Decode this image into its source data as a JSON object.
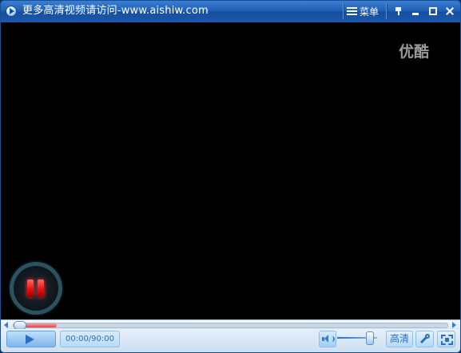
{
  "window": {
    "title": "更多高清视频请访问-www.aishiw.com",
    "menu_label": "菜单"
  },
  "video": {
    "watermark": "优酷",
    "state": "paused"
  },
  "progress": {
    "buffered_fraction": 0.1,
    "played_fraction": 0.0
  },
  "controls": {
    "time": "00:00/90:00",
    "volume_fraction": 0.9,
    "quality_label": "高清"
  },
  "icons": {
    "app": "play-circle-icon",
    "menu": "menu-list-icon",
    "pin": "pin-icon",
    "minimize": "minimize-icon",
    "maximize": "maximize-icon",
    "close": "close-icon",
    "pause": "pause-icon",
    "play": "play-icon",
    "volume": "speaker-icon",
    "settings": "wrench-icon",
    "fullscreen": "fullscreen-icon"
  },
  "colors": {
    "title_bar": "#1f5fb3",
    "control_accent": "#2a6fc0",
    "buffer": "#e04444",
    "pause_glyph": "#e00c0c"
  }
}
